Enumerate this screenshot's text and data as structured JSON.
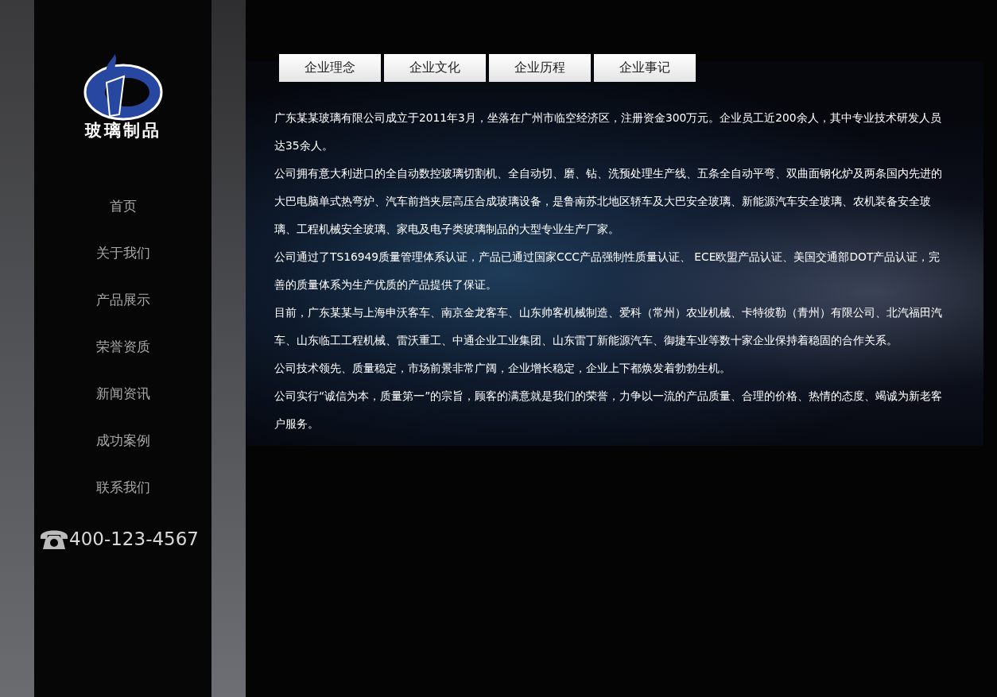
{
  "logo": {
    "text": "玻璃制品"
  },
  "nav": [
    "首页",
    "关于我们",
    "产品展示",
    "荣誉资质",
    "新闻资讯",
    "成功案例",
    "联系我们"
  ],
  "phone": "400-123-4567",
  "tabs": [
    "企业理念",
    "企业文化",
    "企业历程",
    "企业事记"
  ],
  "paragraphs": [
    "广东某某玻璃有限公司成立于2011年3月，坐落在广州市临空经济区，注册资金300万元。企业员工近200余人，其中专业技术研发人员达35余人。",
    "公司拥有意大利进口的全自动数控玻璃切割机、全自动切、磨、钻、洗预处理生产线、五条全自动平弯、双曲面钢化炉及两条国内先进的大巴电脑单式热弯炉、汽车前挡夹层高压合成玻璃设备，是鲁南苏北地区轿车及大巴安全玻璃、新能源汽车安全玻璃、农机装备安全玻璃、工程机械安全玻璃、家电及电子类玻璃制品的大型专业生产厂家。",
    "公司通过了TS16949质量管理体系认证，产品已通过国家CCC产品强制性质量认证、 ECE欧盟产品认证、美国交通部DOT产品认证，完善的质量体系为生产优质的产品提供了保证。",
    "目前，广东某某与上海申沃客车、南京金龙客车、山东帅客机械制造、爱科（常州）农业机械、卡特彼勒（青州）有限公司、北汽福田汽车、山东临工工程机械、雷沃重工、中通企业工业集团、山东雷丁新能源汽车、御捷车业等数十家企业保持着稳固的合作关系。",
    "公司技术领先、质量稳定，市场前景非常广阔，企业增长稳定，企业上下都焕发着勃勃生机。",
    "公司实行“诚信为本，质量第一”的宗旨，顾客的满意就是我们的荣誉，力争以一流的产品质量、合理的价格、热情的态度、竭诚为新老客户服务。"
  ]
}
